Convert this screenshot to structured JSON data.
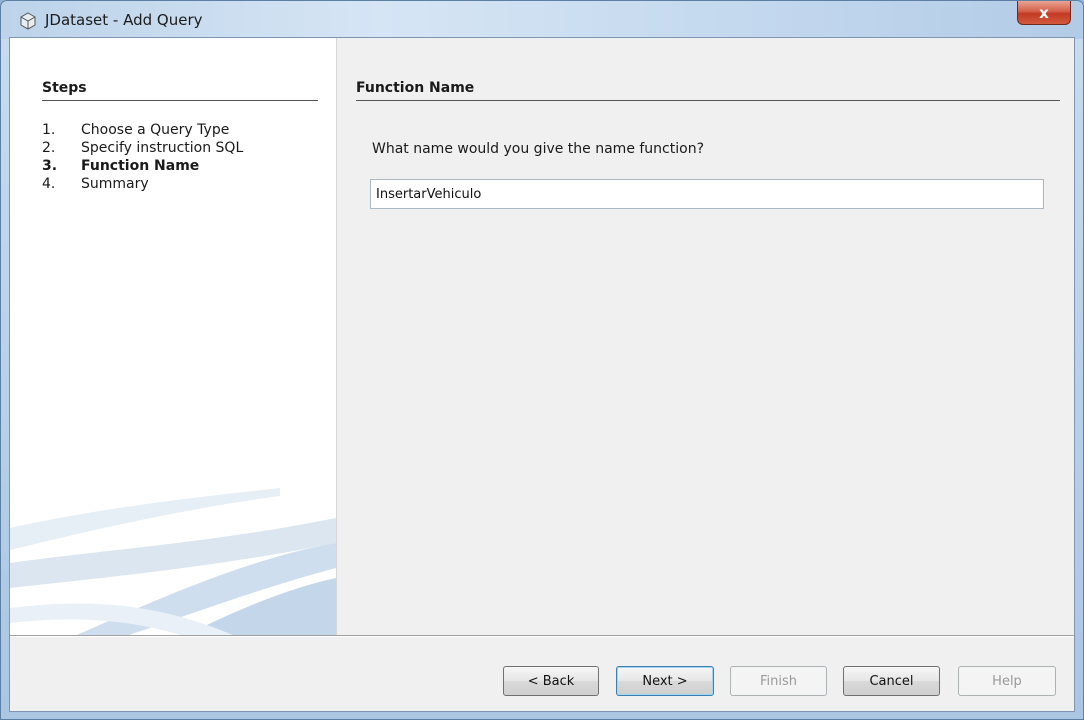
{
  "window": {
    "title": "JDataset - Add Query",
    "close_label": "x",
    "title_icon": "cube-icon"
  },
  "steps": {
    "title": "Steps",
    "items": [
      {
        "num": "1.",
        "label": "Choose a Query Type",
        "current": false
      },
      {
        "num": "2.",
        "label": "Specify instruction SQL",
        "current": false
      },
      {
        "num": "3.",
        "label": "Function Name",
        "current": true
      },
      {
        "num": "4.",
        "label": "Summary",
        "current": false
      }
    ]
  },
  "panel": {
    "title": "Function Name",
    "question": "What name would you give the name function?",
    "function_name_value": "InsertarVehiculo"
  },
  "buttons": {
    "back": "< Back",
    "next": "Next >",
    "finish": "Finish",
    "cancel": "Cancel",
    "help": "Help"
  },
  "colors": {
    "title_bar": "#c9dcef",
    "close_button": "#c23a22",
    "primary_button_border": "#3c7fb1"
  }
}
